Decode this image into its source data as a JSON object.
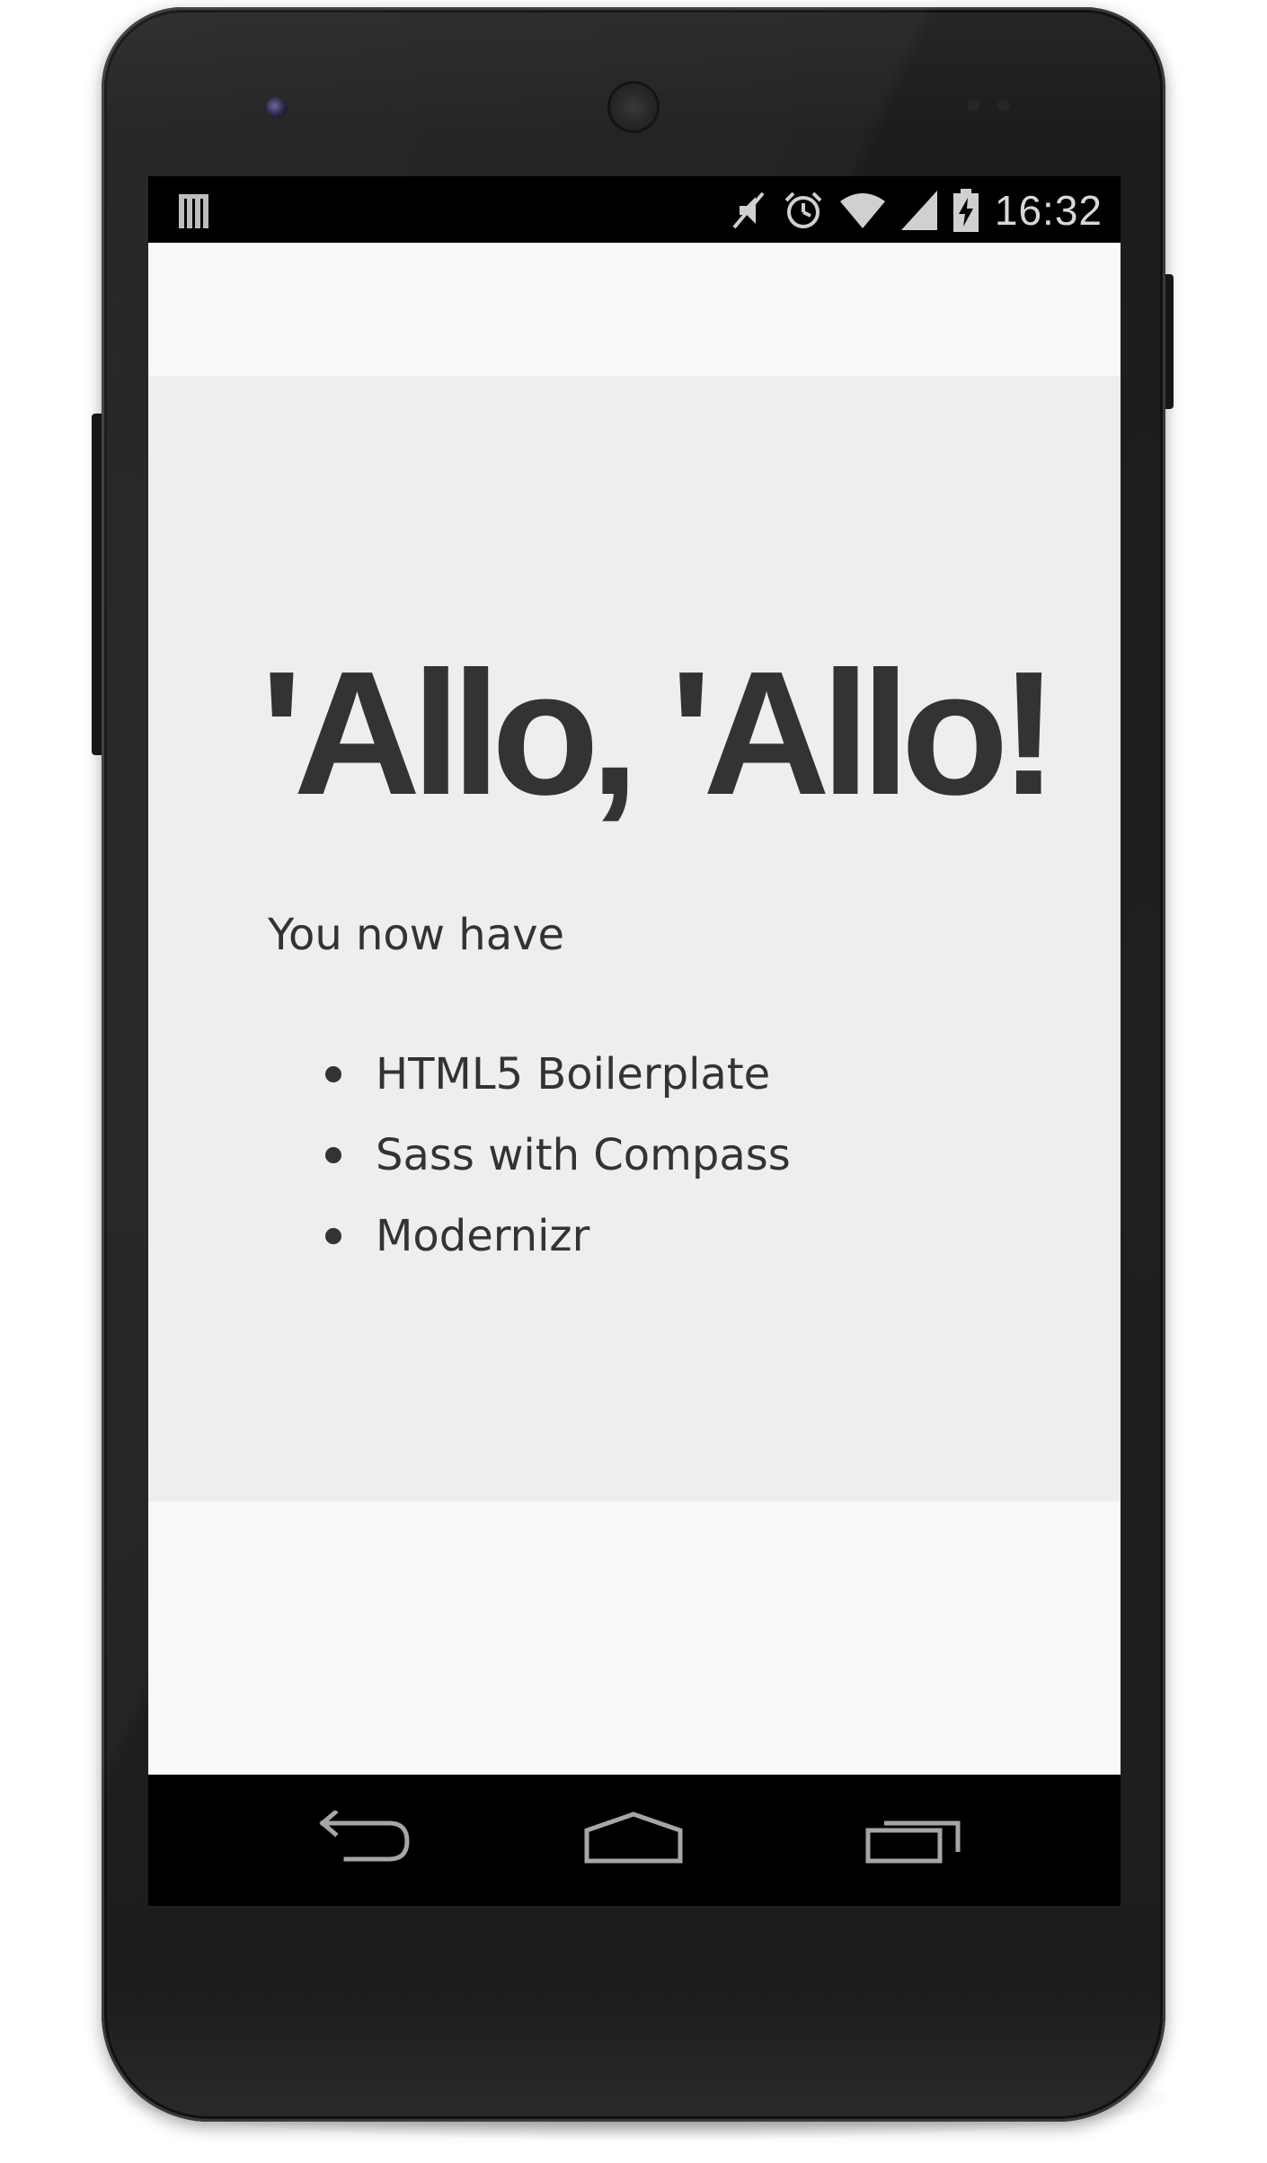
{
  "device": {
    "name": "Android phone"
  },
  "status_bar": {
    "time": "16:32",
    "icons": [
      "notification-icon",
      "mute-icon",
      "alarm-icon",
      "wifi-icon",
      "signal-icon",
      "battery-charging-icon"
    ]
  },
  "page": {
    "headline": "'Allo, 'Allo!",
    "lead": "You now have",
    "features": [
      "HTML5 Boilerplate",
      "Sass with Compass",
      "Modernizr"
    ]
  },
  "nav_bar": {
    "icons": [
      "back-icon",
      "home-icon",
      "recents-icon"
    ]
  },
  "colors": {
    "page_background": "#f9f9f9",
    "jumbotron_background": "#eeeeee",
    "text": "#333333"
  }
}
